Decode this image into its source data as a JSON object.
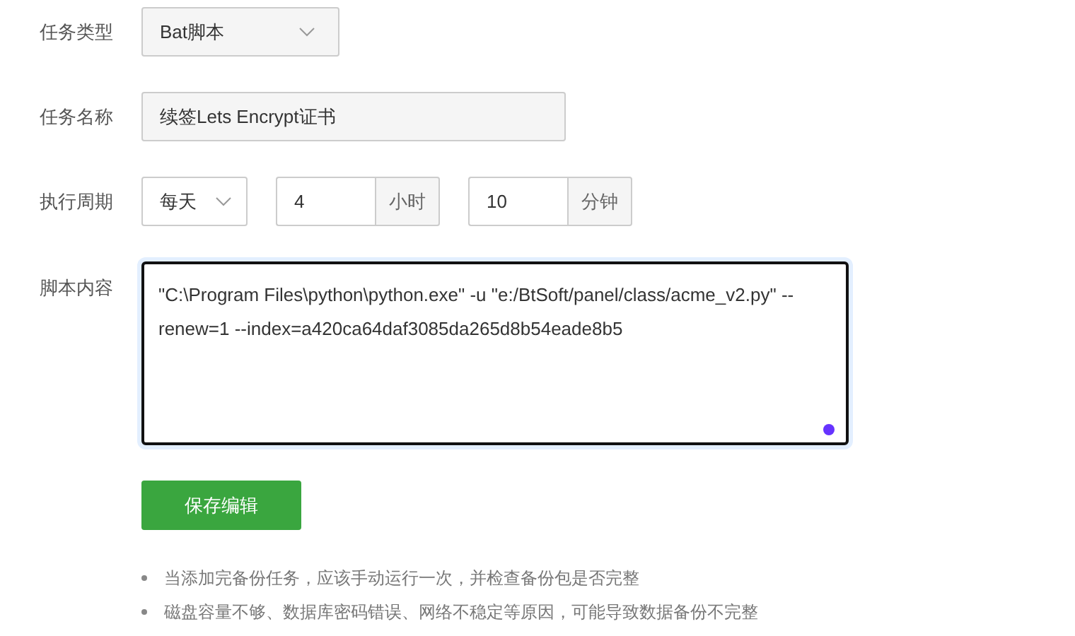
{
  "task_type": {
    "label": "任务类型",
    "value": "Bat脚本"
  },
  "task_name": {
    "label": "任务名称",
    "value": "续签Lets Encrypt证书"
  },
  "period": {
    "label": "执行周期",
    "unit_value": "每天",
    "hours": "4",
    "hours_unit": "小时",
    "minutes": "10",
    "minutes_unit": "分钟"
  },
  "script": {
    "label": "脚本内容",
    "value": "\"C:\\Program Files\\python\\python.exe\" -u \"e:/BtSoft/panel/class/acme_v2.py\" --renew=1 --index=a420ca64daf3085da265d8b54eade8b5",
    "focused": true
  },
  "save_button": "保存编辑",
  "tips": [
    "当添加完备份任务，应该手动运行一次，并检查备份包是否完整",
    "磁盘容量不够、数据库密码错误、网络不稳定等原因，可能导致数据备份不完整"
  ]
}
